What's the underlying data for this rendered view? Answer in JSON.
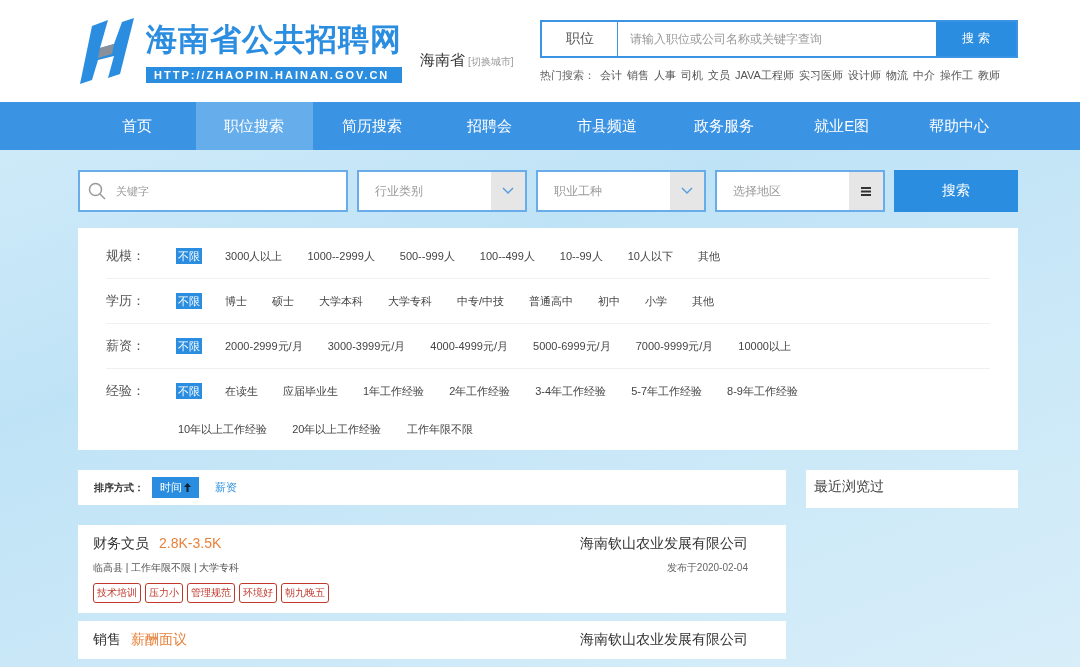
{
  "header": {
    "site_name": "海南省公共招聘网",
    "site_url": "HTTP://ZHAOPIN.HAINAN.GOV.CN",
    "city": "海南省",
    "switch_city": "[切换城市]",
    "search": {
      "category": "职位",
      "placeholder": "请输入职位或公司名称或关键字查询",
      "button": "搜 索"
    },
    "hot_label": "热门搜索：",
    "hot": [
      "会计",
      "销售",
      "人事",
      "司机",
      "文员",
      "JAVA工程师",
      "实习医师",
      "设计师",
      "物流",
      "中介",
      "操作工",
      "教师"
    ]
  },
  "nav": [
    {
      "label": "首页",
      "selected": false
    },
    {
      "label": "职位搜索",
      "selected": true
    },
    {
      "label": "简历搜索",
      "selected": false
    },
    {
      "label": "招聘会",
      "selected": false
    },
    {
      "label": "市县频道",
      "selected": false
    },
    {
      "label": "政务服务",
      "selected": false
    },
    {
      "label": "就业E图",
      "selected": false
    },
    {
      "label": "帮助中心",
      "selected": false
    }
  ],
  "search_bar": {
    "keyword_placeholder": "关键字",
    "industry": "行业类别",
    "occupation": "职业工种",
    "region": "选择地区",
    "button": "搜索"
  },
  "filters": [
    {
      "label": "规模：",
      "options": [
        {
          "text": "不限",
          "selected": true
        },
        {
          "text": "3000人以上",
          "selected": false
        },
        {
          "text": "1000--2999人",
          "selected": false
        },
        {
          "text": "500--999人",
          "selected": false
        },
        {
          "text": "100--499人",
          "selected": false
        },
        {
          "text": "10--99人",
          "selected": false
        },
        {
          "text": "10人以下",
          "selected": false
        },
        {
          "text": "其他",
          "selected": false
        }
      ]
    },
    {
      "label": "学历：",
      "options": [
        {
          "text": "不限",
          "selected": true
        },
        {
          "text": "博士",
          "selected": false
        },
        {
          "text": "硕士",
          "selected": false
        },
        {
          "text": "大学本科",
          "selected": false
        },
        {
          "text": "大学专科",
          "selected": false
        },
        {
          "text": "中专/中技",
          "selected": false
        },
        {
          "text": "普通高中",
          "selected": false
        },
        {
          "text": "初中",
          "selected": false
        },
        {
          "text": "小学",
          "selected": false
        },
        {
          "text": "其他",
          "selected": false
        }
      ]
    },
    {
      "label": "薪资：",
      "options": [
        {
          "text": "不限",
          "selected": true
        },
        {
          "text": "2000-2999元/月",
          "selected": false
        },
        {
          "text": "3000-3999元/月",
          "selected": false
        },
        {
          "text": "4000-4999元/月",
          "selected": false
        },
        {
          "text": "5000-6999元/月",
          "selected": false
        },
        {
          "text": "7000-9999元/月",
          "selected": false
        },
        {
          "text": "10000以上",
          "selected": false
        }
      ]
    },
    {
      "label": "经验：",
      "options": [
        {
          "text": "不限",
          "selected": true
        },
        {
          "text": "在读生",
          "selected": false
        },
        {
          "text": "应届毕业生",
          "selected": false
        },
        {
          "text": "1年工作经验",
          "selected": false
        },
        {
          "text": "2年工作经验",
          "selected": false
        },
        {
          "text": "3-4年工作经验",
          "selected": false
        },
        {
          "text": "5-7年工作经验",
          "selected": false
        },
        {
          "text": "8-9年工作经验",
          "selected": false
        },
        {
          "text": "10年以上工作经验",
          "selected": false
        },
        {
          "text": "20年以上工作经验",
          "selected": false
        },
        {
          "text": "工作年限不限",
          "selected": false
        }
      ]
    }
  ],
  "sort": {
    "label": "排序方式：",
    "options": [
      {
        "text": "时间",
        "selected": true
      },
      {
        "text": "薪资",
        "selected": false
      }
    ]
  },
  "recent": {
    "title": "最近浏览过"
  },
  "jobs": [
    {
      "title": "财务文员",
      "salary": "2.8K-3.5K",
      "company": "海南钦山农业发展有限公司",
      "meta": "临高县 | 工作年限不限 | 大学专科",
      "date": "发布于2020-02-04",
      "tags": [
        "技术培训",
        "压力小",
        "管理规范",
        "环境好",
        "朝九晚五"
      ]
    },
    {
      "title": "销售",
      "salary": "薪酬面议",
      "company": "海南钦山农业发展有限公司"
    }
  ]
}
